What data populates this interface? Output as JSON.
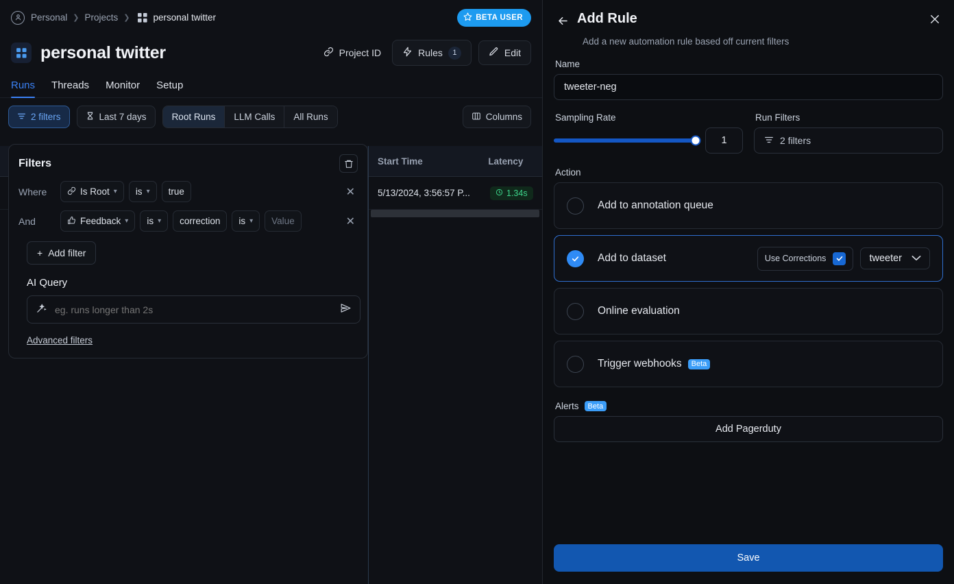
{
  "breadcrumb": {
    "user_icon": "user-icon",
    "items": [
      "Personal",
      "Projects",
      "personal twitter"
    ],
    "project_icon": "grid-icon",
    "beta_badge": {
      "icon": "star-icon",
      "label": "BETA USER",
      "color": "#1d9bf0"
    }
  },
  "project": {
    "icon": "grid-icon",
    "title": "personal twitter",
    "actions": {
      "project_id": "Project ID",
      "rules": "Rules",
      "rules_count": "1",
      "edit": "Edit"
    }
  },
  "tabs": [
    {
      "label": "Runs",
      "active": true
    },
    {
      "label": "Threads",
      "active": false
    },
    {
      "label": "Monitor",
      "active": false
    },
    {
      "label": "Setup",
      "active": false
    }
  ],
  "filter_bar": {
    "filters_chip": "2 filters",
    "date_chip": "Last 7 days",
    "segments": [
      "Root Runs",
      "LLM Calls",
      "All Runs"
    ],
    "segment_active": "Root Runs",
    "columns": "Columns"
  },
  "filters_popover": {
    "title": "Filters",
    "delete_icon": "trash-icon",
    "rows": [
      {
        "conjunction": "Where",
        "field_icon": "link-icon",
        "field": "Is Root",
        "operator": "is",
        "value": "true",
        "value_is_placeholder": false
      },
      {
        "conjunction": "And",
        "field_icon": "thumbs-up-icon",
        "field": "Feedback",
        "operator": "is",
        "key": "correction",
        "operator2": "is",
        "value": "Value",
        "value_is_placeholder": true
      }
    ],
    "add_filter": "Add filter",
    "ai_query_label": "AI Query",
    "ai_query_placeholder": "eg. runs longer than 2s",
    "ai_query_value": "",
    "ai_query_icon": "magic-wand-icon",
    "send_icon": "send-icon",
    "advanced_filters": "Advanced filters"
  },
  "table": {
    "columns": [
      "Start Time",
      "Latency"
    ],
    "rows": [
      {
        "start_time": "5/13/2024, 3:56:57 P...",
        "latency": "1.34s",
        "latency_icon": "clock-icon"
      }
    ]
  },
  "panel": {
    "back_icon": "arrow-left-icon",
    "title": "Add Rule",
    "subtitle": "Add a new automation rule based off current filters",
    "close_icon": "close-icon",
    "name_label": "Name",
    "name_value": "tweeter-neg",
    "name_placeholder": "",
    "sampling_label": "Sampling Rate",
    "sampling_value": "1",
    "sampling_percent": 100,
    "run_filters_label": "Run Filters",
    "run_filters_value": "2 filters",
    "run_filters_icon": "filter-icon",
    "action_label": "Action",
    "actions": [
      {
        "label": "Add to annotation queue",
        "selected": false,
        "badge": ""
      },
      {
        "label": "Add to dataset",
        "selected": true,
        "badge": ""
      },
      {
        "label": "Online evaluation",
        "selected": false,
        "badge": ""
      },
      {
        "label": "Trigger webhooks",
        "selected": false,
        "badge": "Beta"
      }
    ],
    "use_corrections_label": "Use Corrections",
    "use_corrections_checked": true,
    "dataset_value": "tweeter",
    "alerts_label": "Alerts",
    "alerts_badge": "Beta",
    "add_pagerduty": "Add Pagerduty",
    "save": "Save"
  },
  "colors": {
    "accent_blue": "#3b82f6",
    "badge_blue": "#1d9bf0",
    "save_blue": "#1257b0",
    "latency_green": "#3dd68c",
    "bg": "#0d0f13"
  }
}
